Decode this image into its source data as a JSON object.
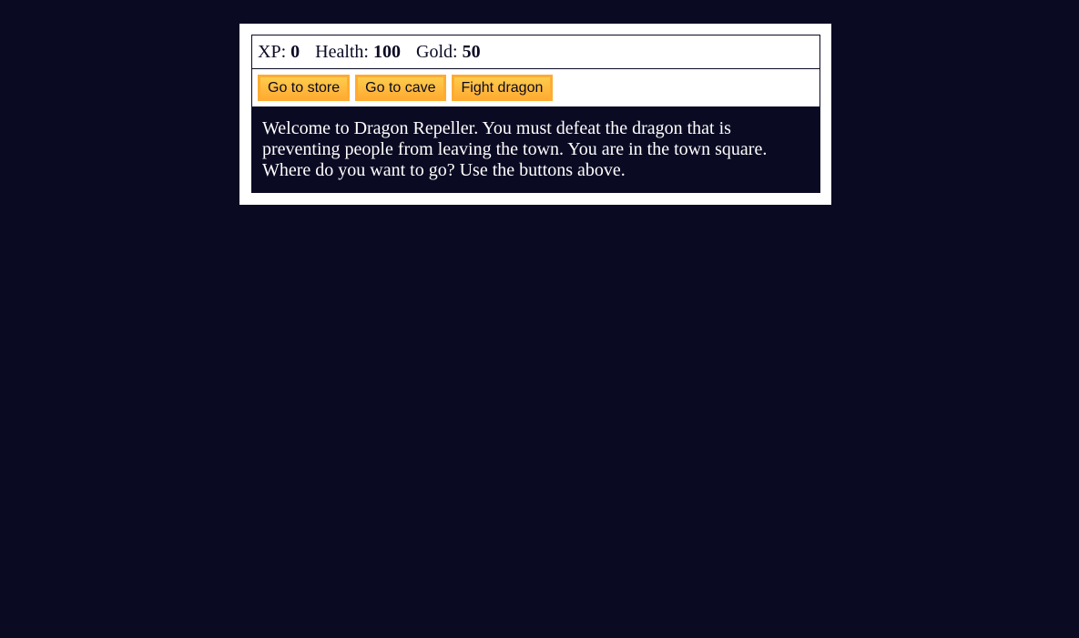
{
  "stats": {
    "xp_label": "XP:",
    "xp_value": "0",
    "health_label": "Health:",
    "health_value": "100",
    "gold_label": "Gold:",
    "gold_value": "50"
  },
  "controls": {
    "store_label": "Go to store",
    "cave_label": "Go to cave",
    "dragon_label": "Fight dragon"
  },
  "text": {
    "message": "Welcome to Dragon Repeller. You must defeat the dragon that is preventing people from leaving the town. You are in the town square. Where do you want to go? Use the buttons above."
  },
  "colors": {
    "background": "#0a0a23",
    "panel": "#ffffff",
    "button": "#feac32"
  }
}
